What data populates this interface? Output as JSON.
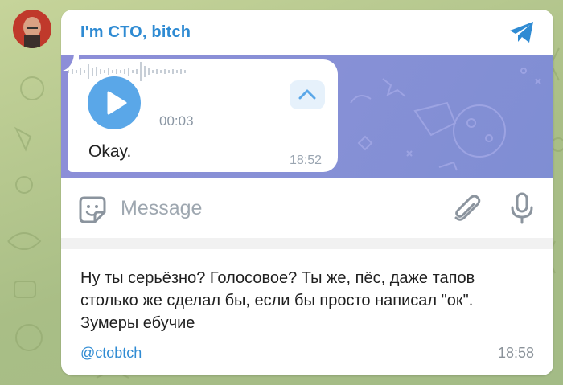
{
  "channel": {
    "name": "I'm CTO, bitch",
    "avatar_icon": "profile-photo",
    "share_icon": "telegram-send-icon"
  },
  "screenshot": {
    "voice_message": {
      "duration": "00:03",
      "transcription": "Okay.",
      "time": "18:52",
      "play_icon": "play-icon",
      "expand_icon": "chevron-up-icon"
    },
    "composer": {
      "placeholder": "Message",
      "sticker_icon": "sticker-icon",
      "attach_icon": "paperclip-icon",
      "mic_icon": "microphone-icon"
    }
  },
  "post": {
    "text": "Ну ты серьёзно? Голосовое? Ты же, пёс, даже тапов столько же сделал бы, если бы просто написал \"ок\". Зумеры ебучие",
    "author": "@ctobtch",
    "time": "18:58"
  },
  "colors": {
    "accent": "#2f8bd3",
    "wallpaper": "#b9c98f",
    "chat_background": "#8790d6",
    "play_button": "#5aa7e8"
  }
}
